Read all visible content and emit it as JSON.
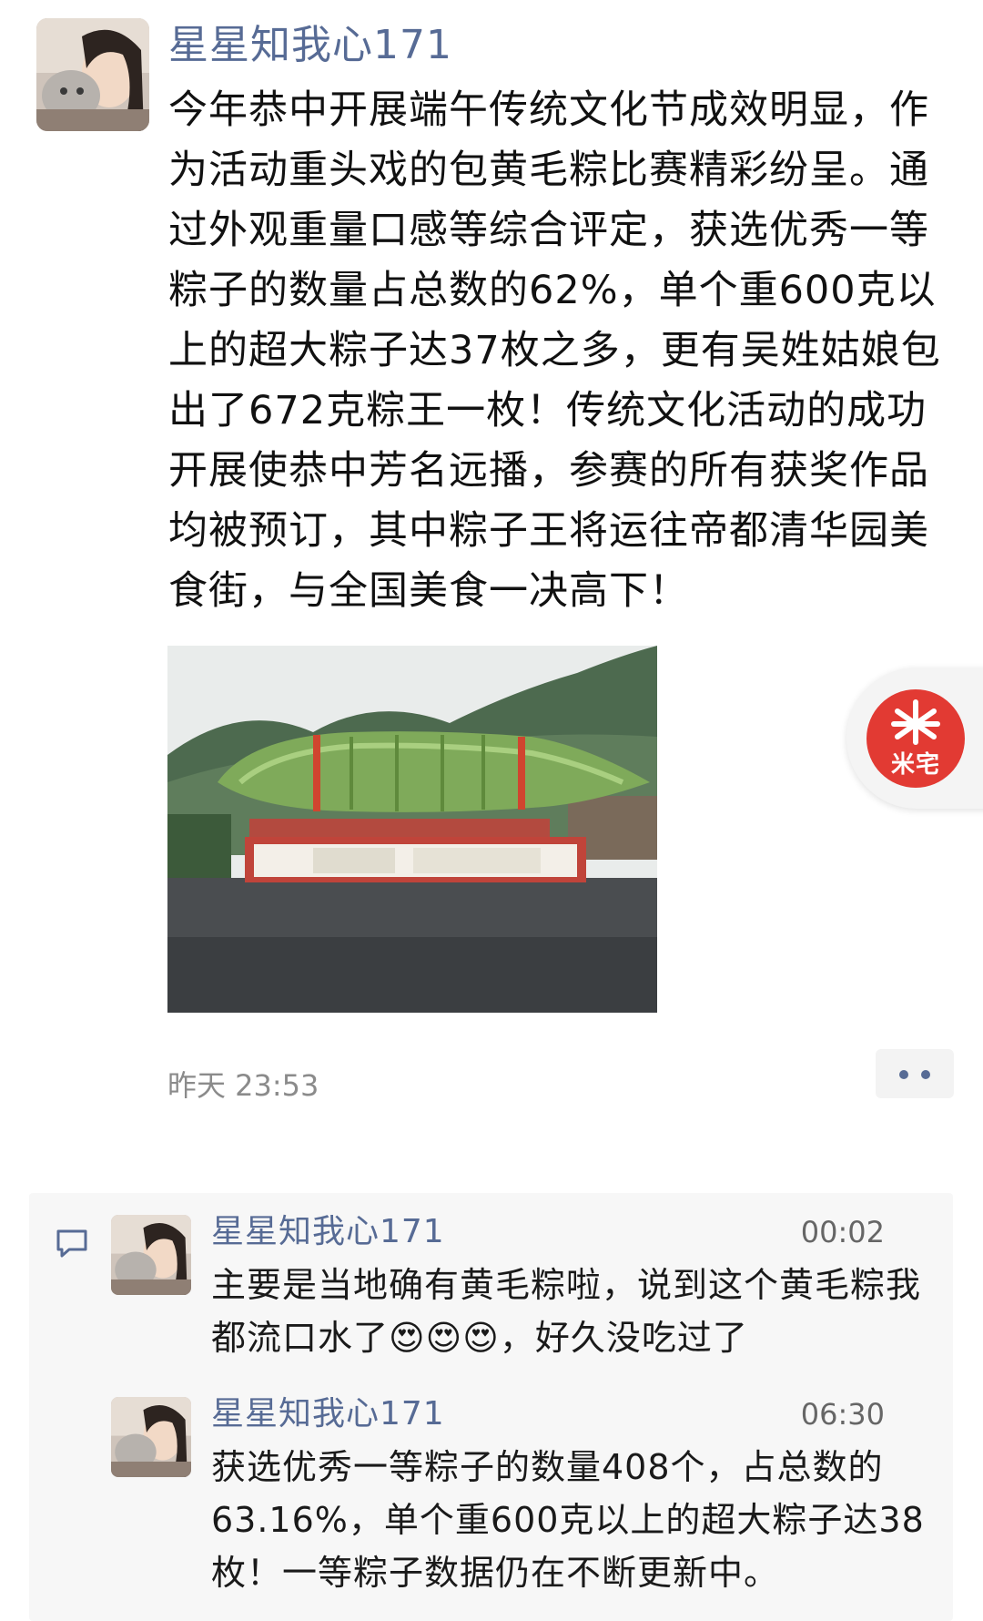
{
  "post": {
    "author": "星星知我心171",
    "text": "今年恭中开展端午传统文化节成效明显，作为活动重头戏的包黄毛粽比赛精彩纷呈。通过外观重量口感等综合评定，获选优秀一等粽子的数量占总数的62%，单个重600克以上的超大粽子达37枚之多，更有吴姓姑娘包出了672克粽王一枚！传统文化活动的成功开展使恭中芳名远播，参赛的所有获奖作品均被预订，其中粽子王将运往帝都清华园美食街，与全国美食一决高下！",
    "time": "昨天 23:53"
  },
  "badge": {
    "label": "米宅",
    "color": "#e23a33"
  },
  "comments": [
    {
      "author": "星星知我心171",
      "time": "00:02",
      "text": "主要是当地确有黄毛粽啦，说到这个黄毛粽我都流口水了😍😍😍，好久没吃过了"
    },
    {
      "author": "星星知我心171",
      "time": "06:30",
      "text": "获选优秀一等粽子的数量408个，占总数的63.16%，单个重600克以上的超大粽子达38枚！一等粽子数据仍在不断更新中。"
    }
  ],
  "colors": {
    "link": "#576b95",
    "muted": "#8b8b8b",
    "panel": "#f7f7f7"
  },
  "icons": {
    "comment": "comment-icon",
    "more": "more-icon"
  }
}
